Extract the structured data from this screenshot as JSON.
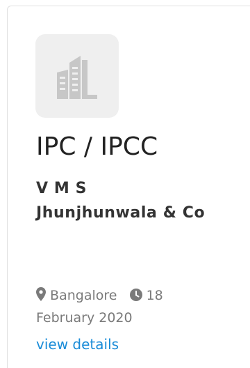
{
  "card": {
    "logo": {
      "icon": "building-icon",
      "background": "#efefef"
    },
    "title": "IPC / IPCC",
    "company": "V M S Jhunjhunwala & Co",
    "location": {
      "icon": "map-marker-icon",
      "text": "Bangalore"
    },
    "date": {
      "icon": "clock-icon",
      "text": "18 February 2020"
    },
    "link_label": "view details"
  },
  "colors": {
    "title": "#222222",
    "company": "#333333",
    "meta": "#7a7a7a",
    "link": "#1a8cd8"
  }
}
